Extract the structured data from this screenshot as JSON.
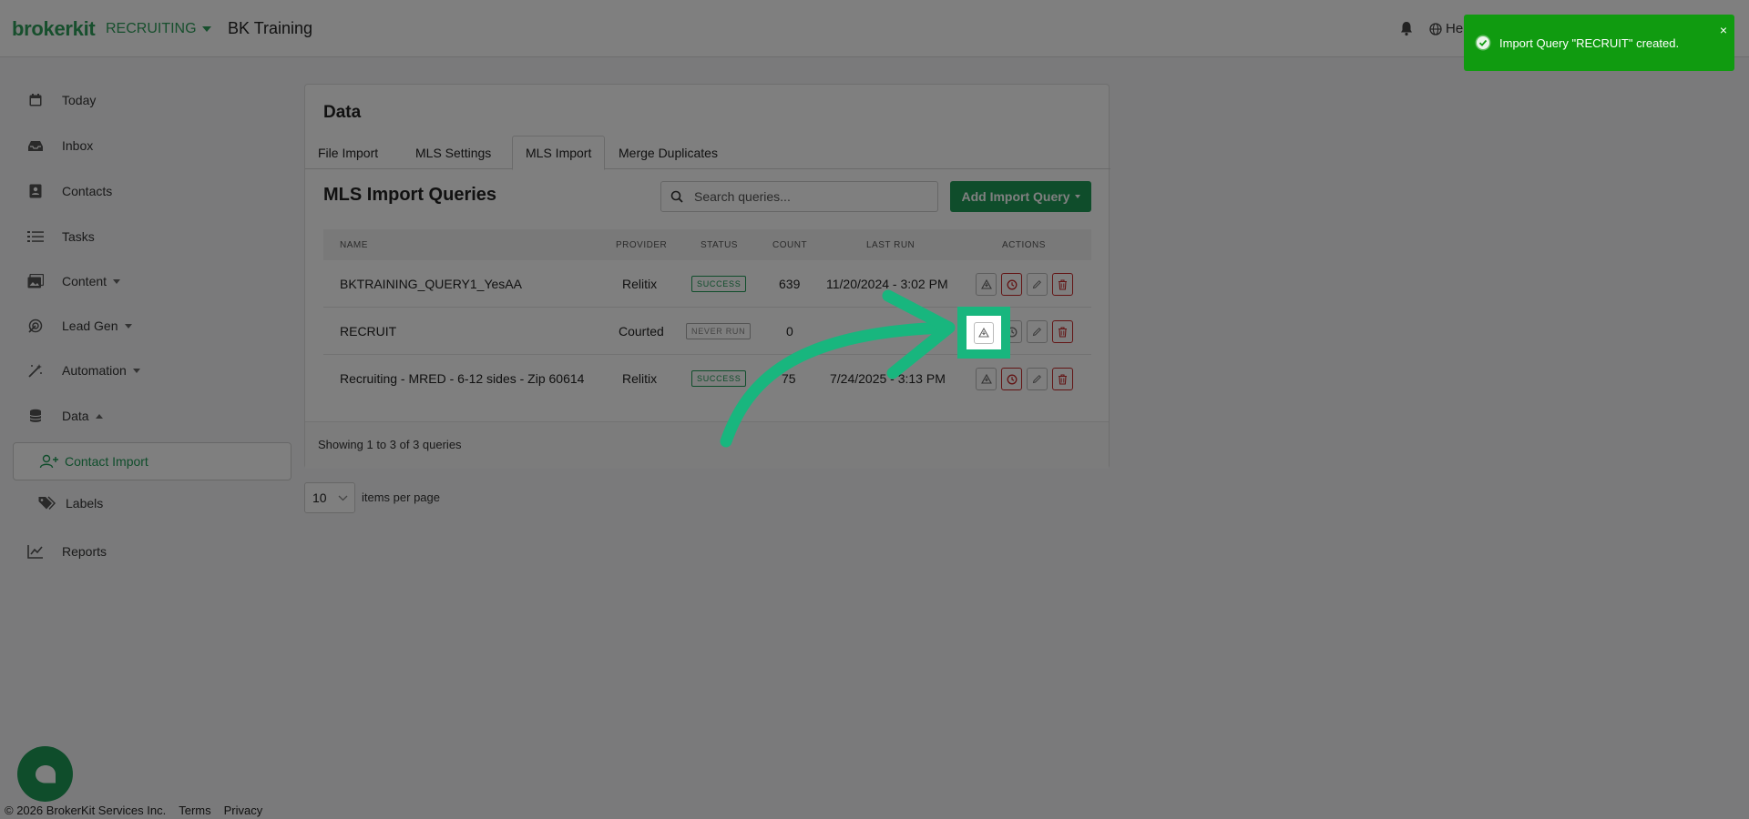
{
  "header": {
    "brand": "brokerkit",
    "org": "RECRUITING",
    "workspace": "BK Training",
    "help": "He"
  },
  "sidebar": {
    "items": [
      {
        "label": "Today",
        "icon": "calendar-icon"
      },
      {
        "label": "Inbox",
        "icon": "inbox-icon"
      },
      {
        "label": "Contacts",
        "icon": "contacts-icon"
      },
      {
        "label": "Tasks",
        "icon": "tasks-icon"
      },
      {
        "label": "Content",
        "icon": "content-icon"
      },
      {
        "label": "Lead Gen",
        "icon": "lead-gen-icon"
      },
      {
        "label": "Automation",
        "icon": "automation-icon"
      },
      {
        "label": "Data",
        "icon": "database-icon"
      },
      {
        "label": "Contact Import",
        "icon": "add-user-icon"
      },
      {
        "label": "Labels",
        "icon": "labels-icon"
      },
      {
        "label": "Reports",
        "icon": "reports-icon"
      }
    ]
  },
  "card": {
    "title": "Data",
    "tabs": [
      "File Import",
      "MLS Settings",
      "MLS Import",
      "Merge Duplicates"
    ],
    "active_tab": "MLS Import",
    "section_title": "MLS Import Queries",
    "search_placeholder": "Search queries...",
    "add_button": "Add Import Query",
    "columns": [
      "NAME",
      "PROVIDER",
      "STATUS",
      "COUNT",
      "LAST RUN",
      "ACTIONS"
    ],
    "rows": [
      {
        "name": "BKTRAINING_QUERY1_YesAA",
        "provider": "Relitix",
        "status": "SUCCESS",
        "count": "639",
        "last_run": "11/20/2024 - 3:02 PM"
      },
      {
        "name": "RECRUIT",
        "provider": "Courted",
        "status": "NEVER RUN",
        "count": "0",
        "last_run": ""
      },
      {
        "name": "Recruiting - MRED - 6-12 sides - Zip 60614",
        "provider": "Relitix",
        "status": "SUCCESS",
        "count": "75",
        "last_run": "7/24/2025 - 3:13 PM"
      }
    ],
    "footer": "Showing 1 to 3 of 3 queries"
  },
  "pagination": {
    "per_page": "10",
    "label": "items per page"
  },
  "footer": {
    "copyright": "© 2026 BrokerKit Services Inc.",
    "terms": "Terms",
    "privacy": "Privacy"
  },
  "toast": {
    "message": "Import Query \"RECRUIT\" created.",
    "close": "×"
  },
  "colors": {
    "brand": "#2e9e5b",
    "primary": "#1f9a57",
    "danger": "#c62828",
    "highlight": "#18b67e",
    "toast": "#109b10"
  }
}
